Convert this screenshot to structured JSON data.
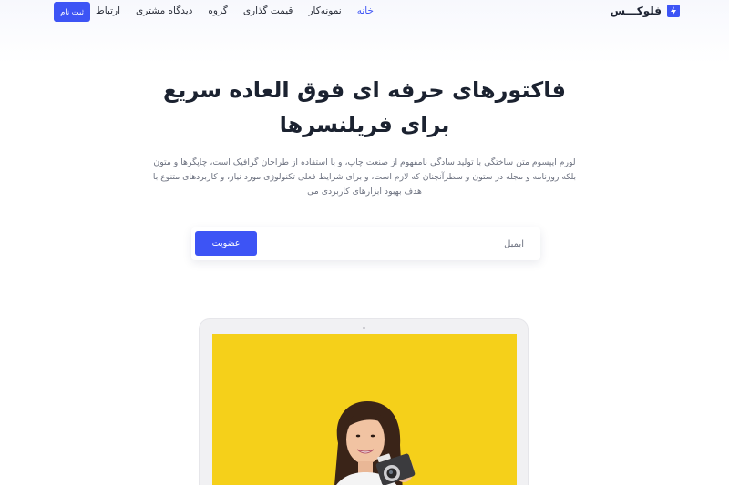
{
  "brand": {
    "name": "فلوکـــس",
    "logo_icon": "flash-logo-icon",
    "accent_color": "#3d54f5"
  },
  "nav": {
    "items": [
      {
        "label": "خانه",
        "active": true
      },
      {
        "label": "نمونه‌کار",
        "active": false
      },
      {
        "label": "قیمت گذاری",
        "active": false
      },
      {
        "label": "گروه",
        "active": false
      },
      {
        "label": "دیدگاه مشتری",
        "active": false
      },
      {
        "label": "ارتباط",
        "active": false
      }
    ],
    "signup_label": "ثبت نام"
  },
  "hero": {
    "title": "فاکتورهای حرفه ای فوق العاده سریع برای فریلنسرها",
    "description": "لورم ایپسوم متن ساختگی با تولید سادگی نامفهوم از صنعت چاپ، و با استفاده از طراحان گرافیک است، چاپگرها و متون بلکه روزنامه و مجله در ستون و سطرآنچنان که لازم است، و برای شرایط فعلی تکنولوژی مورد نیاز، و کاربردهای متنوع با هدف بهبود ابزارهای کاربردی می"
  },
  "signup_form": {
    "email_placeholder": "ایمیل",
    "email_value": "",
    "submit_label": "عضویت"
  },
  "device": {
    "screen_color": "#f5d01a",
    "image": "woman-with-camera-photo"
  }
}
